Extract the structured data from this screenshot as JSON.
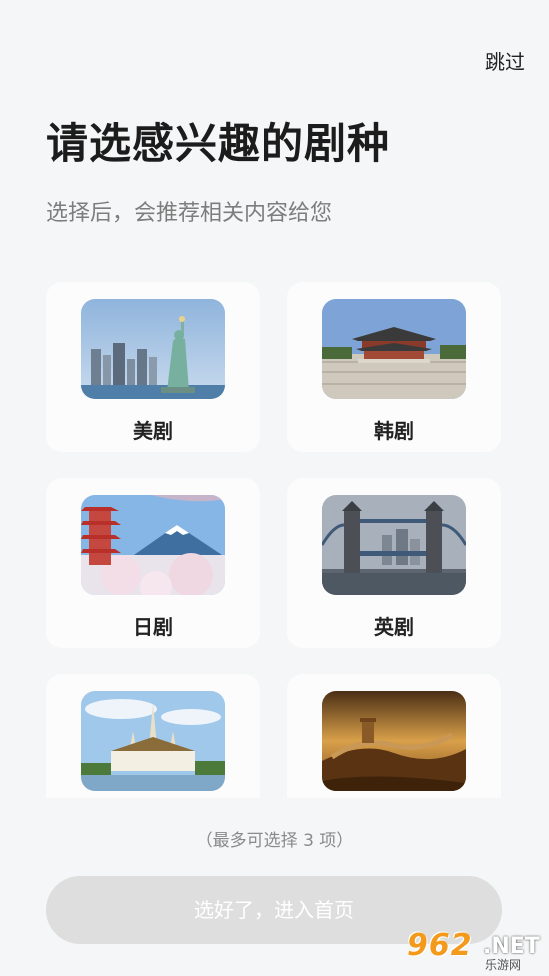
{
  "header": {
    "skip_label": "跳过",
    "title": "请选感兴趣的剧种",
    "subtitle": "选择后，会推荐相关内容给您"
  },
  "genres": [
    {
      "label": "美剧",
      "image": "statue-of-liberty"
    },
    {
      "label": "韩剧",
      "image": "korean-palace"
    },
    {
      "label": "日剧",
      "image": "mount-fuji-pagoda"
    },
    {
      "label": "英剧",
      "image": "tower-bridge"
    },
    {
      "label": "",
      "image": "thai-temple"
    },
    {
      "label": "",
      "image": "great-wall"
    }
  ],
  "footer": {
    "hint": "（最多可选择 3 项）",
    "confirm_label": "选好了，进入首页"
  },
  "watermark": {
    "number": "962",
    "suffix": ".NET",
    "subtitle": "乐游网"
  },
  "colors": {
    "background": "#f5f6f7",
    "card": "#fcfcfc",
    "button_disabled": "#dedede"
  }
}
